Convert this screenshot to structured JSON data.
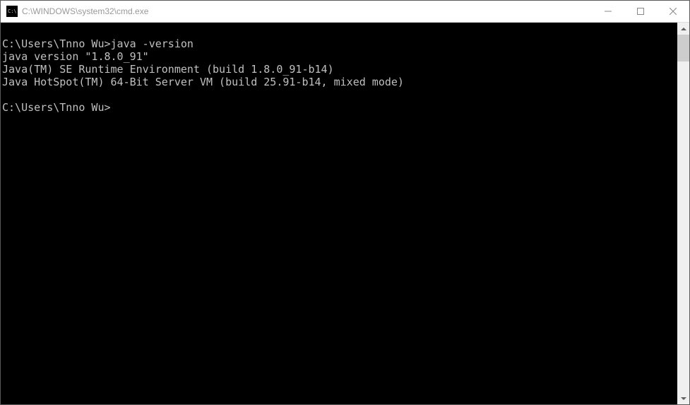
{
  "window": {
    "title": "C:\\WINDOWS\\system32\\cmd.exe",
    "icon_label": "C:\\"
  },
  "console": {
    "lines": [
      "",
      "C:\\Users\\Tnno Wu>java -version",
      "java version \"1.8.0_91\"",
      "Java(TM) SE Runtime Environment (build 1.8.0_91-b14)",
      "Java HotSpot(TM) 64-Bit Server VM (build 25.91-b14, mixed mode)",
      "",
      "C:\\Users\\Tnno Wu>"
    ]
  }
}
